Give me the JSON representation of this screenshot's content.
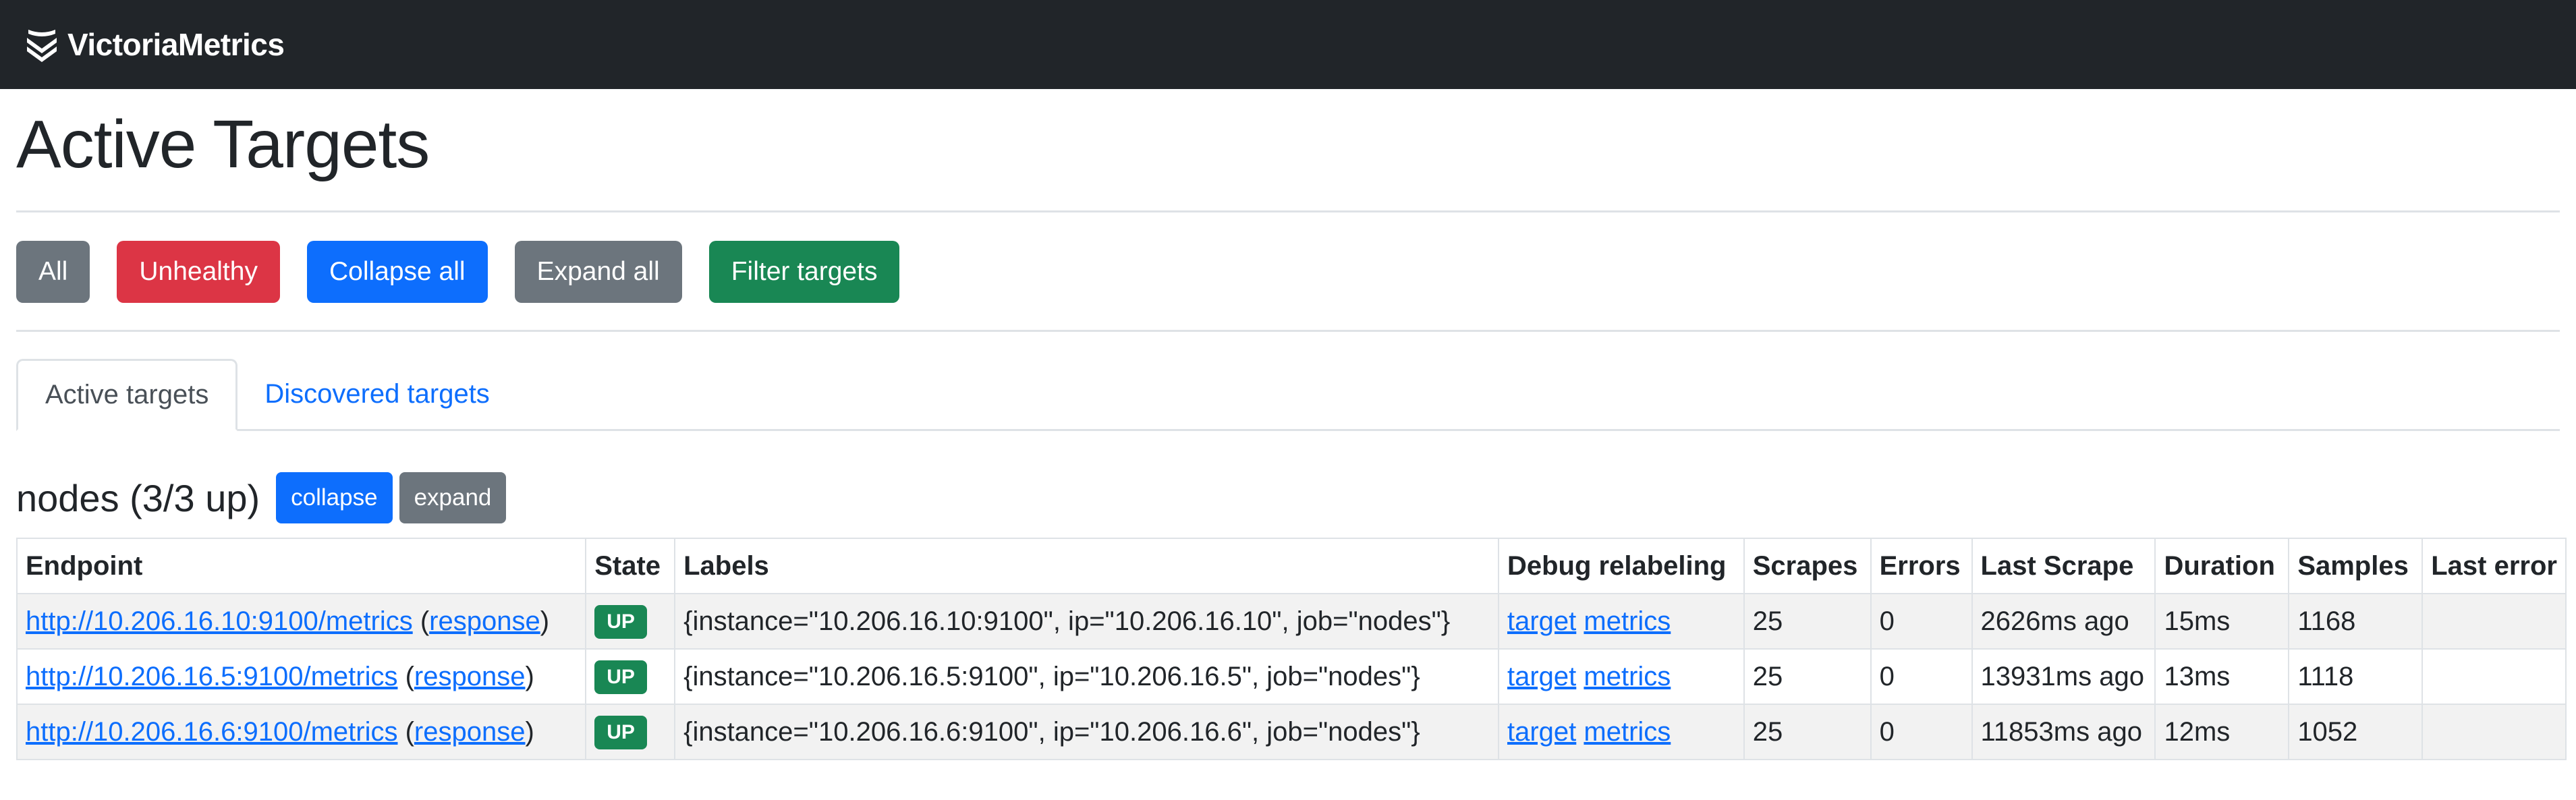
{
  "navbar": {
    "brand": "VictoriaMetrics",
    "logo_icon": "victoriametrics-logo-icon"
  },
  "page": {
    "title": "Active Targets"
  },
  "filters": {
    "all": "All",
    "unhealthy": "Unhealthy",
    "collapse_all": "Collapse all",
    "expand_all": "Expand all",
    "filter_targets": "Filter targets"
  },
  "tabs": [
    {
      "label": "Active targets",
      "active": true
    },
    {
      "label": "Discovered targets",
      "active": false
    }
  ],
  "group": {
    "title": "nodes (3/3 up)",
    "collapse": "collapse",
    "expand": "expand"
  },
  "table": {
    "headers": [
      "Endpoint",
      "State",
      "Labels",
      "Debug relabeling",
      "Scrapes",
      "Errors",
      "Last Scrape",
      "Duration",
      "Samples",
      "Last error"
    ],
    "rows": [
      {
        "endpoint": "http://10.206.16.10:9100/metrics",
        "response_open": " (",
        "response": "response",
        "response_close": ")",
        "state": "UP",
        "labels": "{instance=\"10.206.16.10:9100\", ip=\"10.206.16.10\", job=\"nodes\"}",
        "debug_target": "target",
        "debug_metrics": "metrics",
        "scrapes": "25",
        "errors": "0",
        "last_scrape": "2626ms ago",
        "duration": "15ms",
        "samples": "1168",
        "last_error": ""
      },
      {
        "endpoint": "http://10.206.16.5:9100/metrics",
        "response_open": " (",
        "response": "response",
        "response_close": ")",
        "state": "UP",
        "labels": "{instance=\"10.206.16.5:9100\", ip=\"10.206.16.5\", job=\"nodes\"}",
        "debug_target": "target",
        "debug_metrics": "metrics",
        "scrapes": "25",
        "errors": "0",
        "last_scrape": "13931ms ago",
        "duration": "13ms",
        "samples": "1118",
        "last_error": ""
      },
      {
        "endpoint": "http://10.206.16.6:9100/metrics",
        "response_open": " (",
        "response": "response",
        "response_close": ")",
        "state": "UP",
        "labels": "{instance=\"10.206.16.6:9100\", ip=\"10.206.16.6\", job=\"nodes\"}",
        "debug_target": "target",
        "debug_metrics": "metrics",
        "scrapes": "25",
        "errors": "0",
        "last_scrape": "11853ms ago",
        "duration": "12ms",
        "samples": "1052",
        "last_error": ""
      }
    ]
  },
  "colors": {
    "navbar_bg": "#212529",
    "secondary": "#6c757d",
    "danger": "#dc3545",
    "primary": "#0d6efd",
    "success": "#198754"
  }
}
